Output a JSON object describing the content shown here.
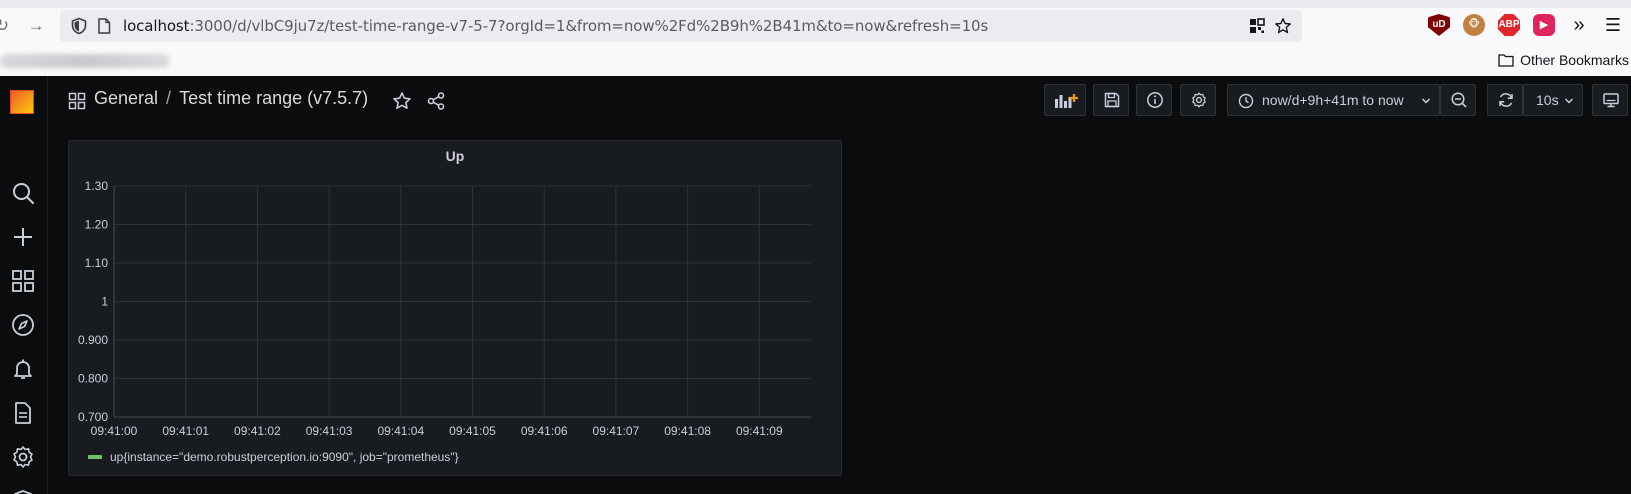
{
  "browser": {
    "url_host": "localhost",
    "url_rest": ":3000/d/vlbC9ju7z/test-time-range-v7-5-7?orgId=1&from=now%2Fd%2B9h%2B41m&to=now&refresh=10s",
    "other_bookmarks": "Other Bookmarks",
    "ext_ublock": "uD",
    "ext_abp": "ABP"
  },
  "dashboard": {
    "folder": "General",
    "separator": "/",
    "title": "Test time range (v7.5.7)",
    "time_range": "now/d+9h+41m to now",
    "refresh_interval": "10s"
  },
  "panel": {
    "title": "Up",
    "legend": "up{instance=\"demo.robustperception.io:9090\", job=\"prometheus\"}"
  },
  "chart_data": {
    "type": "line",
    "title": "Up",
    "x": [
      "09:41:00",
      "09:41:01",
      "09:41:02",
      "09:41:03",
      "09:41:04",
      "09:41:05",
      "09:41:06",
      "09:41:07",
      "09:41:08",
      "09:41:09"
    ],
    "y_ticks": [
      "0.700",
      "0.800",
      "0.900",
      "1",
      "1.10",
      "1.20",
      "1.30"
    ],
    "ylim": [
      0.7,
      1.3
    ],
    "series": [
      {
        "name": "up{instance=\"demo.robustperception.io:9090\", job=\"prometheus\"}",
        "values": [],
        "color": "#73bf69"
      }
    ],
    "grid": true,
    "legend_position": "bottom-left"
  },
  "colors": {
    "background": "#0b0c0e",
    "panel": "#181b1f",
    "grid": "#2f3238",
    "series": "#73bf69"
  }
}
